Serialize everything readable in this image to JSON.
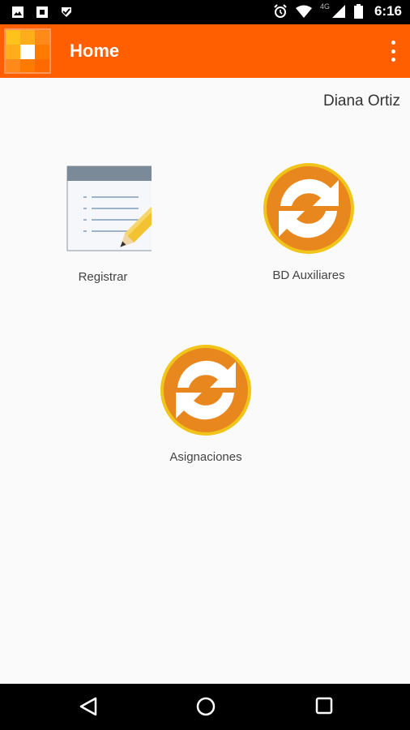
{
  "status_bar": {
    "time": "6:16",
    "network": "4G",
    "icons": [
      "image-icon",
      "stop-icon",
      "check-shield-icon",
      "alarm-icon",
      "wifi-icon",
      "cell-signal-icon",
      "battery-icon"
    ]
  },
  "app_bar": {
    "title": "Home",
    "brand_color": "#ff5f00"
  },
  "user": {
    "name": "Diana Ortiz"
  },
  "tiles": [
    {
      "label": "Registrar",
      "icon": "notepad-pencil-icon"
    },
    {
      "label": "BD Auxiliares",
      "icon": "sync-icon"
    },
    {
      "label": "Asignaciones",
      "icon": "sync-icon"
    }
  ],
  "nav_bar": {
    "icons": [
      "back-icon",
      "home-icon",
      "recents-icon"
    ]
  }
}
